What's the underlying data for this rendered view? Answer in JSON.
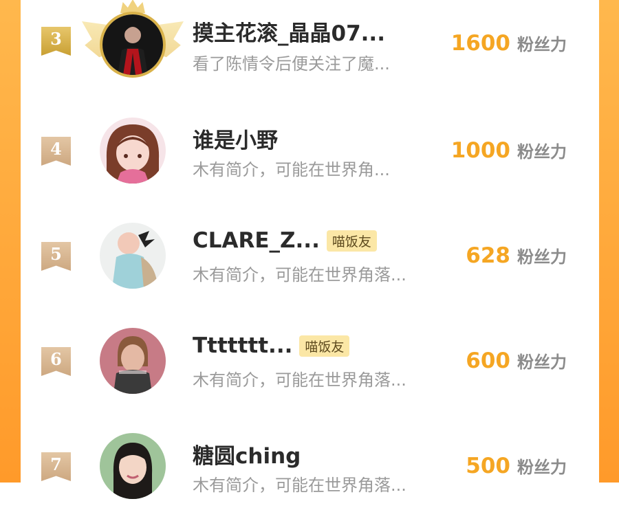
{
  "colors": {
    "accent": "#f5a623",
    "edge": "#ff9a2a",
    "badge_bg": "#fbe7a6"
  },
  "rows": [
    {
      "rank": "3",
      "name": "摸主花滚_晶晶07...",
      "badge": "",
      "bio": "看了陈情令后便关注了魔...",
      "score": "1600",
      "unit": "粉丝力"
    },
    {
      "rank": "4",
      "name": "谁是小野",
      "badge": "",
      "bio": "木有简介，可能在世界角...",
      "score": "1000",
      "unit": "粉丝力"
    },
    {
      "rank": "5",
      "name": "CLARE_Z...",
      "badge": "喵饭友",
      "bio": "木有简介，可能在世界角落...",
      "score": "628",
      "unit": "粉丝力"
    },
    {
      "rank": "6",
      "name": "Ttttttt...",
      "badge": "喵饭友",
      "bio": "木有简介，可能在世界角落...",
      "score": "600",
      "unit": "粉丝力"
    },
    {
      "rank": "7",
      "name": "糖圆ching",
      "badge": "",
      "bio": "木有简介，可能在世界角落...",
      "score": "500",
      "unit": "粉丝力"
    }
  ]
}
